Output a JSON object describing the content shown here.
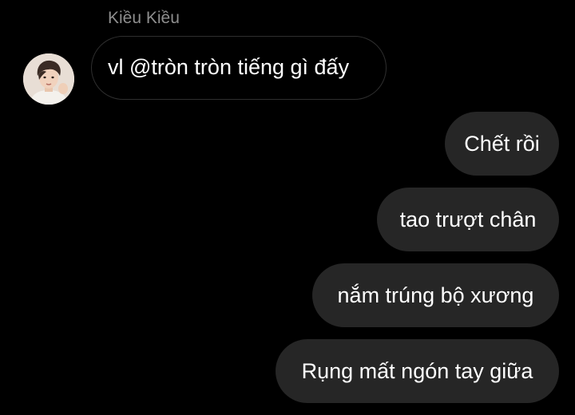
{
  "thread": {
    "incoming": {
      "sender_name": "Kiều Kiều",
      "avatar_icon": "profile-photo",
      "message": "vl @tròn tròn tiếng gì đấy"
    },
    "outgoing_messages": [
      "Chết rồi",
      "tao trượt chân",
      "nắm trúng bộ xương",
      "Rụng mất ngón tay giữa"
    ]
  },
  "colors": {
    "background": "#000000",
    "sender_name": "#8e8e8e",
    "incoming_border": "#2f2f2f",
    "outgoing_bubble": "#262626",
    "text": "#ffffff"
  }
}
